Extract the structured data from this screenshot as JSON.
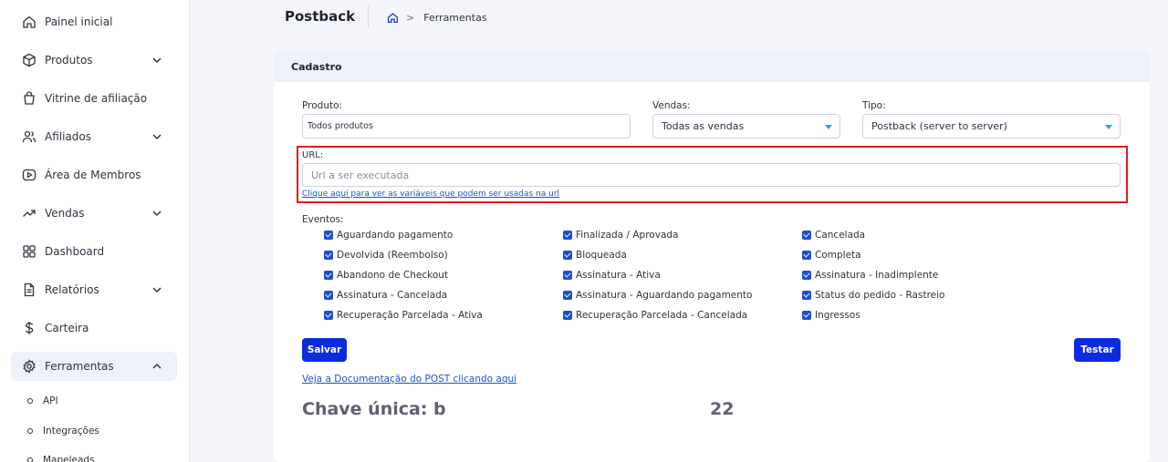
{
  "sidebar": {
    "items": [
      {
        "label": "Painel inicial",
        "icon": "home-icon"
      },
      {
        "label": "Produtos",
        "icon": "box-icon"
      },
      {
        "label": "Vitrine de afiliação",
        "icon": "shopping-bag-icon"
      },
      {
        "label": "Afiliados",
        "icon": "users-icon"
      },
      {
        "label": "Área de Membros",
        "icon": "play-icon"
      },
      {
        "label": "Vendas",
        "icon": "trending-icon"
      },
      {
        "label": "Dashboard",
        "icon": "grid-icon"
      },
      {
        "label": "Relatórios",
        "icon": "document-icon"
      },
      {
        "label": "Carteira",
        "icon": "dollar-icon"
      },
      {
        "label": "Ferramentas",
        "icon": "gear-icon"
      }
    ],
    "subitems": [
      {
        "label": "API"
      },
      {
        "label": "Integrações"
      },
      {
        "label": "Mapeleads"
      }
    ]
  },
  "header": {
    "title": "Postback",
    "breadcrumb": [
      "Ferramentas"
    ]
  },
  "card": {
    "title": "Cadastro",
    "produto": {
      "label": "Produto:",
      "value": "Todos produtos"
    },
    "vendas": {
      "label": "Vendas:",
      "value": "Todas as vendas"
    },
    "tipo": {
      "label": "Tipo:",
      "value": "Postback (server to server)"
    },
    "url": {
      "label": "URL:",
      "placeholder": "Url a ser executada",
      "help_link": "Clique aqui para ver as variáveis que podem ser usadas na url"
    },
    "eventos": {
      "label": "Eventos:",
      "columns": [
        [
          "Aguardando pagamento",
          "Devolvida (Reembolso)",
          "Abandono de Checkout",
          "Assinatura - Cancelada",
          "Recuperação Parcelada - Ativa"
        ],
        [
          "Finalizada / Aprovada",
          "Bloqueada",
          "Assinatura - Ativa",
          "Assinatura - Aguardando pagamento",
          "Recuperação Parcelada - Cancelada"
        ],
        [
          "Cancelada",
          "Completa",
          "Assinatura - Inadimplente",
          "Status do pedido - Rastreio",
          "Ingressos"
        ]
      ]
    },
    "save_label": "Salvar",
    "test_label": "Testar",
    "doc_link": "Veja a Documentação do POST clicando aqui",
    "key_label": "Chave única: b",
    "key_value": "22"
  },
  "colors": {
    "accent": "#0b2be0",
    "highlight": "#e01b1b",
    "caret": "#1ea7e8"
  }
}
